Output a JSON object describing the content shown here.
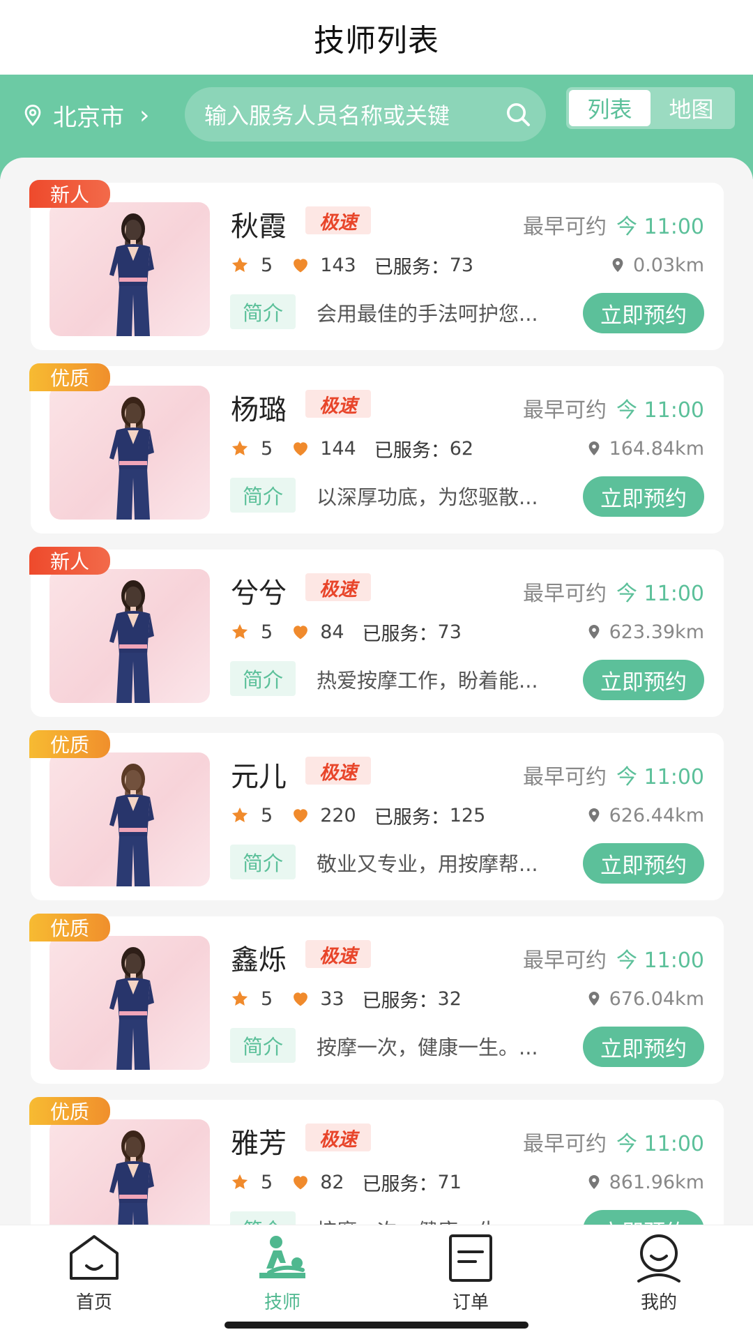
{
  "header": {
    "title": "技师列表",
    "city": "北京市",
    "search_placeholder": "输入服务人员名称或关键",
    "view_list": "列表",
    "view_map": "地图"
  },
  "labels": {
    "earliest": "最早可约",
    "served": "已服务：",
    "intro": "简介",
    "book": "立即预约",
    "fast": "极速"
  },
  "colors": {
    "brand_green": "#6ccaa4",
    "button_green": "#5cc09a",
    "tag_new": "#ee4a2c",
    "tag_good": "#f7bb32",
    "fast_red": "#e8452a"
  },
  "technicians": [
    {
      "tag": "新人",
      "name": "秋霞",
      "time": "今 11:00",
      "rating": "5",
      "likes": "143",
      "served": "73",
      "distance": "0.03km",
      "desc": "会用最佳的手法呵护您..."
    },
    {
      "tag": "优质",
      "name": "杨璐",
      "time": "今 11:00",
      "rating": "5",
      "likes": "144",
      "served": "62",
      "distance": "164.84km",
      "desc": "以深厚功底，为您驱散..."
    },
    {
      "tag": "新人",
      "name": "兮兮",
      "time": "今 11:00",
      "rating": "5",
      "likes": "84",
      "served": "73",
      "distance": "623.39km",
      "desc": "热爱按摩工作，盼着能..."
    },
    {
      "tag": "优质",
      "name": "元儿",
      "time": "今 11:00",
      "rating": "5",
      "likes": "220",
      "served": "125",
      "distance": "626.44km",
      "desc": "敬业又专业，用按摩帮..."
    },
    {
      "tag": "优质",
      "name": "鑫烁",
      "time": "今 11:00",
      "rating": "5",
      "likes": "33",
      "served": "32",
      "distance": "676.04km",
      "desc": "按摩一次，健康一生。..."
    },
    {
      "tag": "优质",
      "name": "雅芳",
      "time": "今 11:00",
      "rating": "5",
      "likes": "82",
      "served": "71",
      "distance": "861.96km",
      "desc": "按摩一次，健康一生。..."
    }
  ],
  "tabbar": {
    "home": "首页",
    "technician": "技师",
    "orders": "订单",
    "mine": "我的"
  }
}
